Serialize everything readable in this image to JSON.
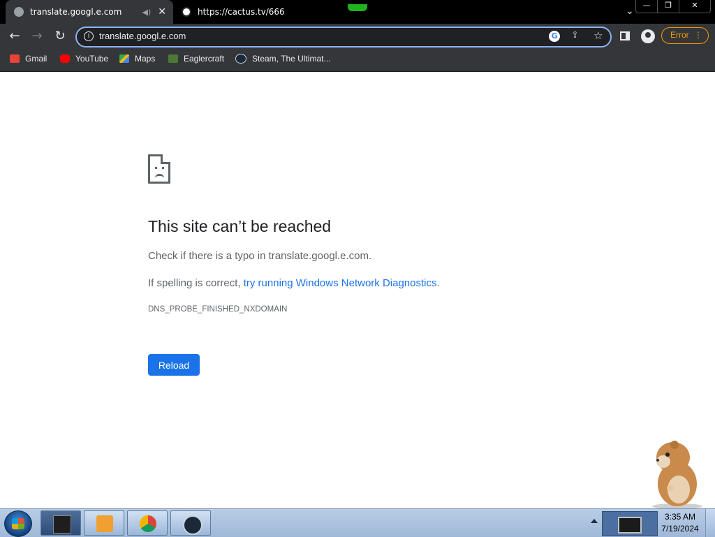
{
  "browser": {
    "tabs": [
      {
        "title": "translate.googl.e.com",
        "active": true,
        "favicon": "globe-icon"
      },
      {
        "title": "https://cactus.tv/666",
        "active": false,
        "favicon": "cactus-favicon"
      }
    ],
    "tab_search_icon": "chevron-down-icon",
    "window_controls": [
      "minimize-icon",
      "restore-icon",
      "close-icon"
    ]
  },
  "toolbar": {
    "back_icon": "arrow-left-icon",
    "forward_icon": "arrow-right-icon",
    "reload_icon": "reload-icon",
    "url": "translate.googl.e.com",
    "error_chip_label": "Error",
    "accent_color": "#8ab4f8",
    "error_color": "#f29900"
  },
  "bookmarks": [
    {
      "label": "Gmail",
      "icon": "gmail-icon"
    },
    {
      "label": "YouTube",
      "icon": "youtube-icon"
    },
    {
      "label": "Maps",
      "icon": "maps-icon"
    },
    {
      "label": "Eaglercraft",
      "icon": "eaglercraft-icon"
    },
    {
      "label": "Steam, The Ultimat...",
      "icon": "steam-icon"
    }
  ],
  "error_page": {
    "title": "This site can’t be reached",
    "line1_prefix": "Check if there is a typo in ",
    "line1_host": "translate.googl.e.com",
    "line1_suffix": ".",
    "line2_prefix": "If spelling is correct, ",
    "line2_link": "try running Windows Network Diagnostics",
    "line2_suffix": ".",
    "error_code": "DNS_PROBE_FINISHED_NXDOMAIN",
    "reload_label": "Reload",
    "button_color": "#1a73e8"
  },
  "taskbar": {
    "items": [
      "window-app-icon",
      "media-player-icon",
      "chrome-icon",
      "steam-icon"
    ],
    "time": "3:35 AM",
    "date": "7/19/2024"
  }
}
